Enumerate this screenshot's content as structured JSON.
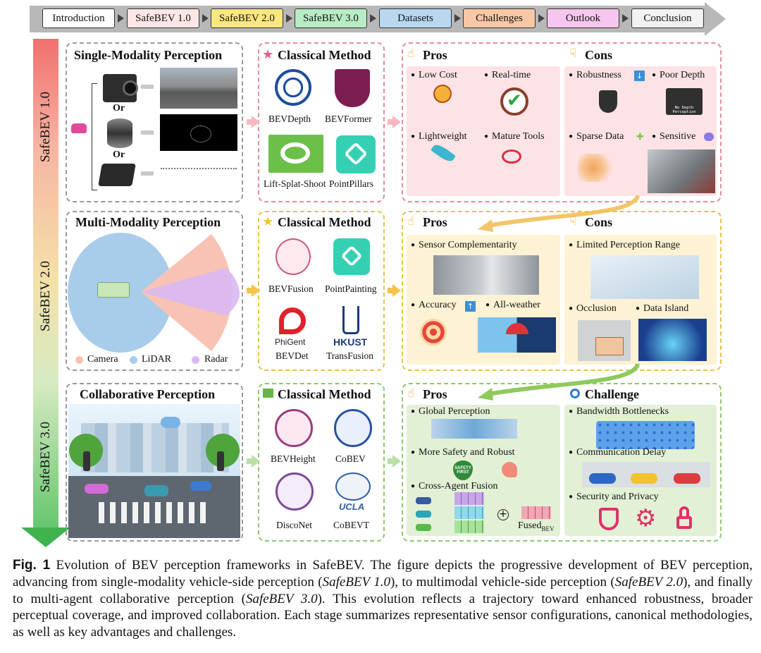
{
  "stages_bar": [
    "Introduction",
    "SafeBEV 1.0",
    "SafeBEV 2.0",
    "SafeBEV 3.0",
    "Datasets",
    "Challenges",
    "Outlook",
    "Conclusion"
  ],
  "stage_colors": [
    "#ffffff",
    "#fde6e6",
    "#fbe680",
    "#b8ecc4",
    "#b8d8f0",
    "#f8c8a6",
    "#f7c6ee",
    "#f2f2f2"
  ],
  "vertical_labels": [
    "SafeBEV 1.0",
    "SafeBEV 2.0",
    "SafeBEV 3.0"
  ],
  "row1": {
    "perception_title": "Single-Modality Perception",
    "or1": "Or",
    "or2": "Or",
    "method_title": "Classical Method",
    "methods": [
      "BEVDepth",
      "BEVFormer",
      "Lift-Splat-Shoot",
      "PointPillars"
    ],
    "pros_title": "Pros",
    "pros": [
      "Low Cost",
      "Real-time",
      "Lightweight",
      "Mature Tools"
    ],
    "cons_title": "Cons",
    "cons": [
      "Robustness",
      "Poor Depth",
      "Sparse Data",
      "Sensitive"
    ],
    "no_depth_text": "No Depth Perception"
  },
  "row2": {
    "perception_title": "Multi-Modality Perception",
    "legend": [
      "Camera",
      "LiDAR",
      "Radar"
    ],
    "method_title": "Classical Method",
    "methods": [
      "BEVFusion",
      "PointPainting",
      "BEVDet",
      "TransFusion"
    ],
    "logo_texts": {
      "phigent": "PhiGent",
      "hkust": "HKUST"
    },
    "pros_title": "Pros",
    "pros": [
      "Sensor Complementarity",
      "Accuracy",
      "All-weather"
    ],
    "cons_title": "Cons",
    "cons": [
      "Limited Perception Range",
      "Occlusion",
      "Data Island"
    ]
  },
  "row3": {
    "perception_title": "Collaborative Perception",
    "method_title": "Classical Method",
    "methods": [
      "BEVHeight",
      "CoBEV",
      "DiscoNet",
      "CoBEVT"
    ],
    "logo_texts": {
      "ucla": "UCLA",
      "safety": "SAFETY FIRST"
    },
    "pros_title": "Pros",
    "pros": [
      "Global Perception",
      "More Safety and Robust",
      "Cross-Agent Fusion"
    ],
    "fused_label": "Fused",
    "fused_sub": "BEV",
    "challenge_title": "Challenge",
    "challenges": [
      "Bandwidth Bottlenecks",
      "Communication Delay",
      "Security and Privacy"
    ]
  },
  "caption": {
    "fig": "Fig. 1",
    "parts": [
      " Evolution of BEV perception frameworks in SafeBEV. The figure depicts the progressive development of BEV perception, advancing from single-modality vehicle-side perception (",
      "SafeBEV 1.0",
      "), to multimodal vehicle-side perception (",
      "SafeBEV 2.0",
      "), and finally to multi-agent collaborative perception (",
      "SafeBEV 3.0",
      "). This evolution reflects a trajectory toward enhanced robustness, broader perceptual coverage, and improved collaboration. Each stage summarizes representative sensor configurations, canonical methodologies, as well as key advantages and challenges."
    ]
  },
  "colors": {
    "red": "#f0a0a8",
    "yellow": "#f3cc55",
    "green": "#8cc96a",
    "pink_fill": "#fde3e6",
    "yellow_fill": "#fdf2d3",
    "green_fill": "#e2f1d5"
  }
}
